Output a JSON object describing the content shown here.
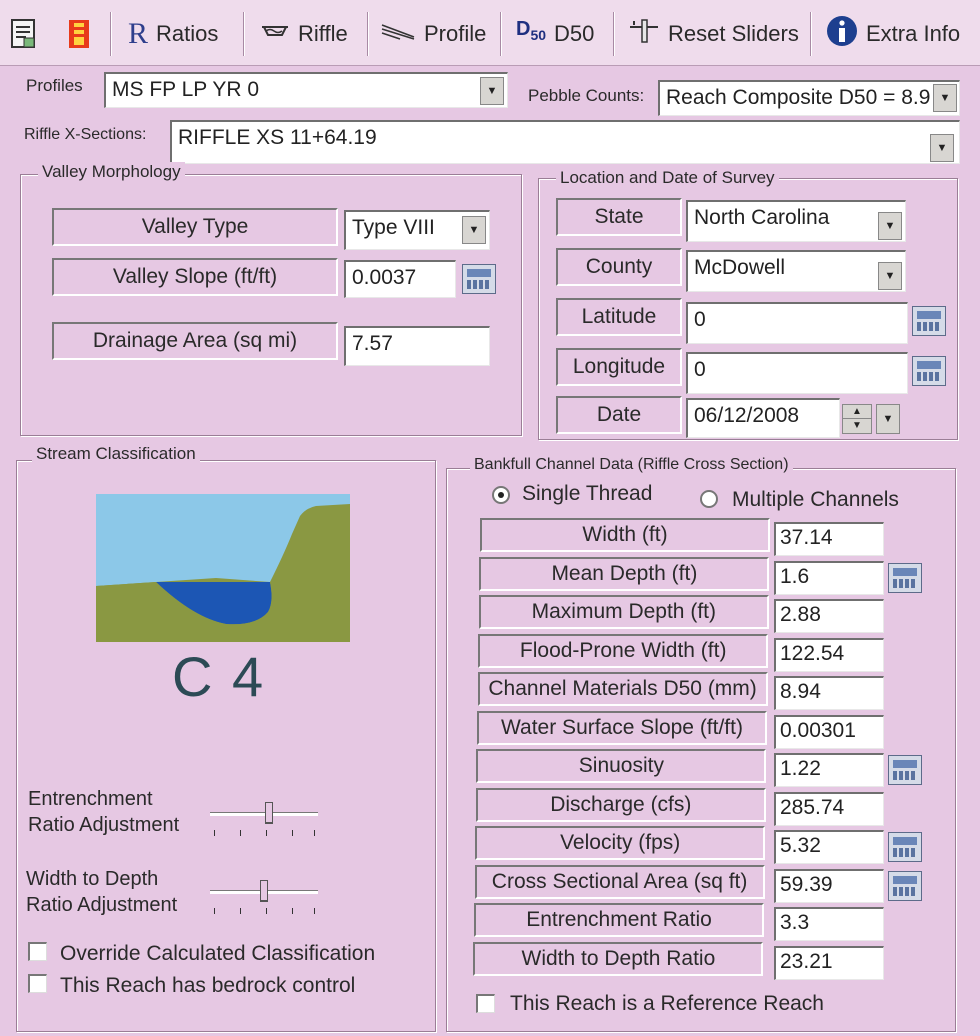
{
  "toolbar": {
    "ratios": "Ratios",
    "riffle": "Riffle",
    "profile": "Profile",
    "d50_icon_text": "D",
    "d50_sub": "50",
    "d50": "D50",
    "reset": "Reset Sliders",
    "extra": "Extra Info"
  },
  "top": {
    "profiles_label": "Profiles",
    "profiles_value": "MS FP LP YR 0",
    "pebble_label": "Pebble Counts:",
    "pebble_value": "Reach Composite D50 = 8.9",
    "riffle_label": "Riffle X-Sections:",
    "riffle_value": "RIFFLE XS 11+64.19"
  },
  "valley": {
    "title": "Valley Morphology",
    "type_label": "Valley Type",
    "type_value": "Type VIII",
    "slope_label": "Valley Slope (ft/ft)",
    "slope_value": "0.0037",
    "drainage_label": "Drainage Area (sq mi)",
    "drainage_value": "7.57"
  },
  "location": {
    "title": "Location and Date of Survey",
    "state_label": "State",
    "state_value": "North Carolina",
    "county_label": "County",
    "county_value": "McDowell",
    "lat_label": "Latitude",
    "lat_value": "0",
    "lon_label": "Longitude",
    "lon_value": "0",
    "date_label": "Date",
    "date_value": "06/12/2008"
  },
  "stream": {
    "title": "Stream Classification",
    "classification": "C 4",
    "entrenchment_adj": [
      "Entrenchment",
      "Ratio Adjustment"
    ],
    "wd_adj": [
      "Width to Depth",
      "Ratio Adjustment"
    ],
    "override_label": "Override Calculated Classification",
    "bedrock_label": "This Reach has bedrock control",
    "entrenchment_slider_level": 0.55,
    "wd_slider_level": 0.5
  },
  "bankfull": {
    "title": "Bankfull Channel Data (Riffle Cross Section)",
    "single_thread": "Single Thread",
    "multiple_channels": "Multiple Channels",
    "rows": [
      {
        "label": "Width (ft)",
        "value": "37.14"
      },
      {
        "label": "Mean Depth (ft)",
        "value": "1.6"
      },
      {
        "label": "Maximum Depth (ft)",
        "value": "2.88"
      },
      {
        "label": "Flood-Prone Width (ft)",
        "value": "122.54"
      },
      {
        "label": "Channel Materials D50 (mm)",
        "value": "8.94"
      },
      {
        "label": "Water Surface Slope (ft/ft)",
        "value": "0.00301"
      },
      {
        "label": "Sinuosity",
        "value": "1.22"
      },
      {
        "label": "Discharge (cfs)",
        "value": "285.74"
      },
      {
        "label": "Velocity (fps)",
        "value": "5.32"
      },
      {
        "label": "Cross Sectional Area (sq ft)",
        "value": "59.39"
      },
      {
        "label": "Entrenchment Ratio",
        "value": "3.3"
      },
      {
        "label": "Width to Depth Ratio",
        "value": "23.21"
      }
    ],
    "reference_label": "This Reach is a Reference Reach"
  },
  "colors": {
    "background": "#e6c8e3",
    "sky": "#8cc8e8",
    "water": "#1c56b4",
    "terrain": "#8a9842",
    "class_text": "#2c4a55"
  }
}
